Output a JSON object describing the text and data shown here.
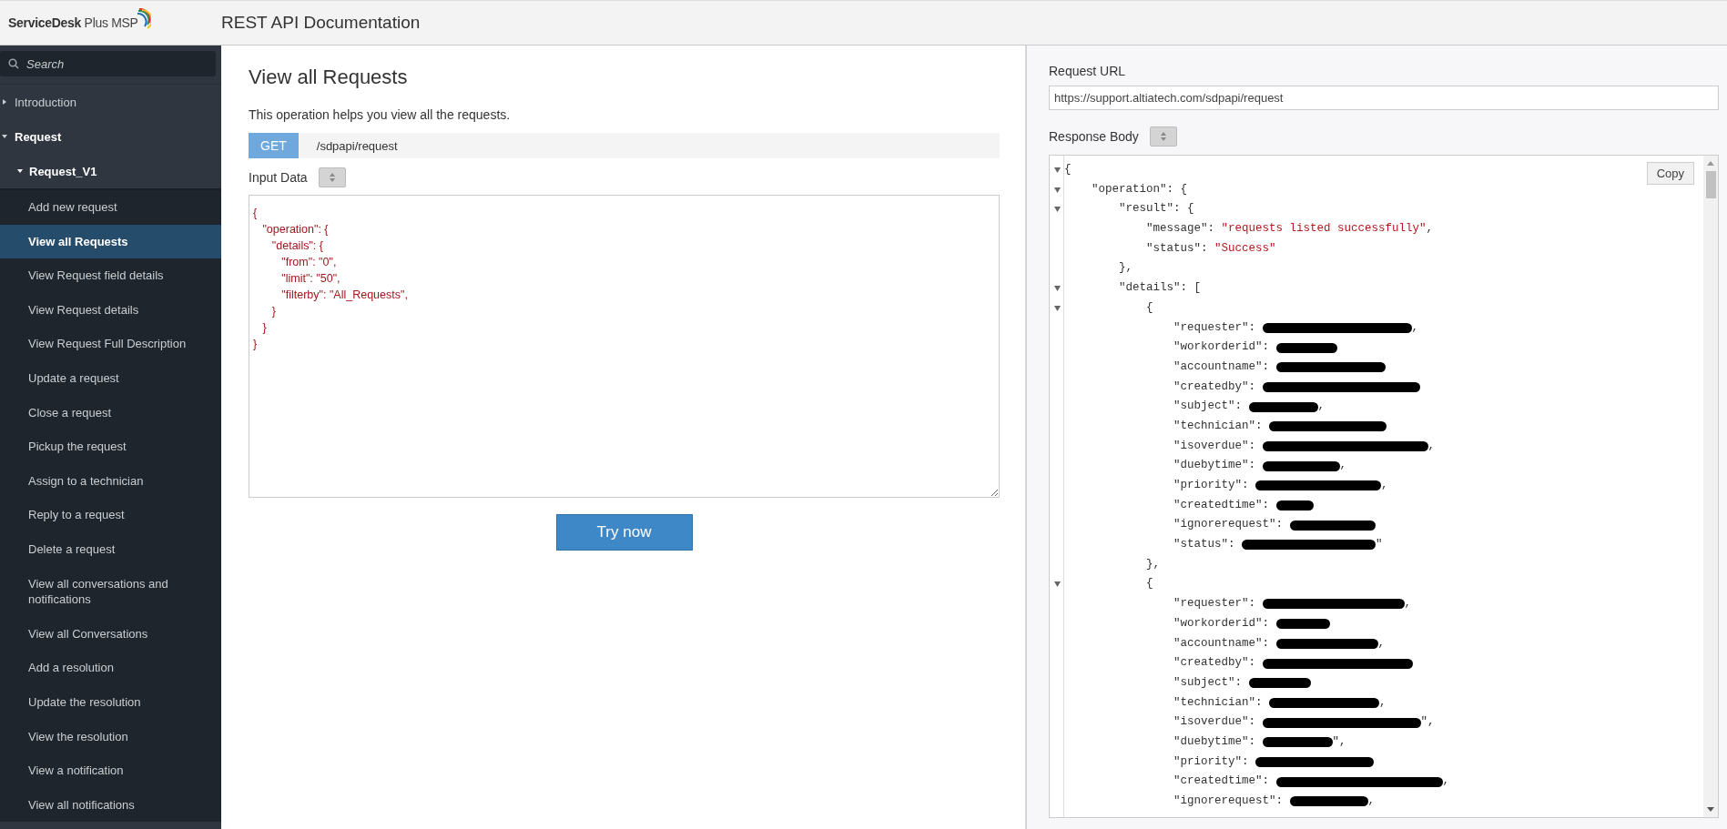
{
  "header": {
    "logo": "**ServiceDesk** Plus MSP",
    "title": "REST API Documentation"
  },
  "sidebar": {
    "search": {
      "placeholder": "Search"
    },
    "items": [
      {
        "label": "Introduction",
        "expanded": false
      },
      {
        "label": "Request",
        "expanded": true,
        "children": [
          {
            "label": "Request_V1",
            "expanded": true,
            "children": [
              {
                "label": "Add new request",
                "selected": false
              },
              {
                "label": "View all Requests",
                "selected": true
              },
              {
                "label": "View Request field details",
                "selected": false
              },
              {
                "label": "View Request details",
                "selected": false
              },
              {
                "label": "View Request Full Description",
                "selected": false
              },
              {
                "label": "Update a request",
                "selected": false
              },
              {
                "label": "Close a request",
                "selected": false
              },
              {
                "label": "Pickup the request",
                "selected": false
              },
              {
                "label": "Assign to a technician",
                "selected": false
              },
              {
                "label": "Reply to a request",
                "selected": false
              },
              {
                "label": "Delete a request",
                "selected": false
              },
              {
                "label": "View all conversations and notifications",
                "selected": false
              },
              {
                "label": "View all Conversations",
                "selected": false
              },
              {
                "label": "Add a resolution",
                "selected": false
              },
              {
                "label": "Update the resolution",
                "selected": false
              },
              {
                "label": "View the resolution",
                "selected": false
              },
              {
                "label": "View a notification",
                "selected": false
              },
              {
                "label": "View all notifications",
                "selected": false
              }
            ]
          }
        ]
      }
    ]
  },
  "operation": {
    "title": "View all Requests",
    "description": "This operation helps you view all the requests.",
    "method": "GET",
    "path": "/sdpapi/request",
    "input_label": "Input Data",
    "input_data": {
      "value": "{\n   \"operation\": {\n      \"details\": {\n         \"from\": \"0\",\n         \"limit\": \"50\",\n         \"filterby\": \"All_Requests\",\n      }\n   }\n}"
    },
    "button": "Try now"
  },
  "response": {
    "url_label": "Request URL",
    "url": "https://support.altiatech.com/sdpapi/request",
    "body_label": "Response Body",
    "copy": "Copy",
    "lines": [
      {
        "fold": true,
        "redacted": false,
        "key": "{"
      },
      {
        "fold": true,
        "redacted": false,
        "key": "    \"operation\": {"
      },
      {
        "fold": true,
        "redacted": false,
        "key": "        \"result\": {"
      },
      {
        "fold": false,
        "redacted": false,
        "key": "            \"message\": ",
        "value": "\"requests listed successfully\"",
        "after": ","
      },
      {
        "fold": false,
        "redacted": false,
        "key": "            \"status\": ",
        "value": "\"Success\""
      },
      {
        "fold": false,
        "redacted": false,
        "key": "        },"
      },
      {
        "fold": true,
        "redacted": false,
        "key": "        \"details\": ["
      },
      {
        "fold": true,
        "redacted": false,
        "key": "            {"
      },
      {
        "fold": false,
        "redacted": true,
        "key": "                \"requester\": ",
        "after": ","
      },
      {
        "fold": false,
        "redacted": true,
        "key": "                \"workorderid\": "
      },
      {
        "fold": false,
        "redacted": true,
        "key": "                \"accountname\": "
      },
      {
        "fold": false,
        "redacted": true,
        "key": "                \"createdby\": "
      },
      {
        "fold": false,
        "redacted": true,
        "key": "                \"subject\": ",
        "after": ","
      },
      {
        "fold": false,
        "redacted": true,
        "key": "                \"technician\": "
      },
      {
        "fold": false,
        "redacted": true,
        "key": "                \"isoverdue\": ",
        "after": ","
      },
      {
        "fold": false,
        "redacted": true,
        "key": "                \"duebytime\": ",
        "after": ","
      },
      {
        "fold": false,
        "redacted": true,
        "key": "                \"priority\": ",
        "after": ","
      },
      {
        "fold": false,
        "redacted": true,
        "key": "                \"createdtime\": "
      },
      {
        "fold": false,
        "redacted": true,
        "key": "                \"ignorerequest\": "
      },
      {
        "fold": false,
        "redacted": true,
        "key": "                \"status\": ",
        "after": "\""
      },
      {
        "fold": false,
        "redacted": false,
        "key": "            },"
      },
      {
        "fold": true,
        "redacted": false,
        "key": "            {"
      },
      {
        "fold": false,
        "redacted": true,
        "key": "                \"requester\": ",
        "after": ","
      },
      {
        "fold": false,
        "redacted": true,
        "key": "                \"workorderid\": "
      },
      {
        "fold": false,
        "redacted": true,
        "key": "                \"accountname\": ",
        "after": ","
      },
      {
        "fold": false,
        "redacted": true,
        "key": "                \"createdby\": "
      },
      {
        "fold": false,
        "redacted": true,
        "key": "                \"subject\": "
      },
      {
        "fold": false,
        "redacted": true,
        "key": "                \"technician\": ",
        "after": ","
      },
      {
        "fold": false,
        "redacted": true,
        "key": "                \"isoverdue\": ",
        "after": "\","
      },
      {
        "fold": false,
        "redacted": true,
        "key": "                \"duebytime\": ",
        "after": "\","
      },
      {
        "fold": false,
        "redacted": true,
        "key": "                \"priority\": "
      },
      {
        "fold": false,
        "redacted": true,
        "key": "                \"createdtime\": ",
        "after": ","
      },
      {
        "fold": false,
        "redacted": true,
        "key": "                \"ignorerequest\": ",
        "after": ","
      }
    ]
  }
}
